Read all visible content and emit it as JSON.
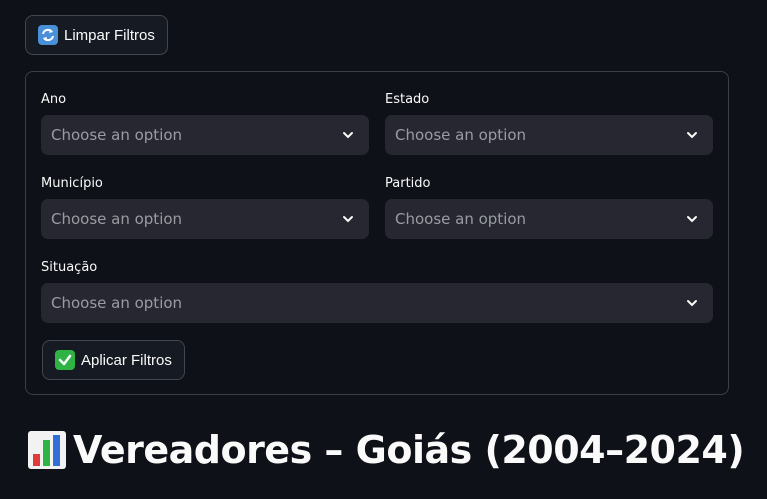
{
  "toolbar": {
    "clear_label": "Limpar Filtros",
    "clear_icon": "arrows-clockwise-icon"
  },
  "filters": {
    "ano": {
      "label": "Ano",
      "value": "Choose an option"
    },
    "estado": {
      "label": "Estado",
      "value": "Choose an option"
    },
    "municipio": {
      "label": "Município",
      "value": "Choose an option"
    },
    "partido": {
      "label": "Partido",
      "value": "Choose an option"
    },
    "situacao": {
      "label": "Situação",
      "value": "Choose an option"
    },
    "apply_label": "Aplicar Filtros",
    "apply_icon": "check-mark-icon"
  },
  "header": {
    "title": "Vereadores – Goiás (2004–2024)",
    "icon": "bar-chart-icon"
  },
  "colors": {
    "background": "#0e1117",
    "select_bg": "#262730",
    "border": "#3a3e48",
    "accent_check": "#2fb344"
  }
}
